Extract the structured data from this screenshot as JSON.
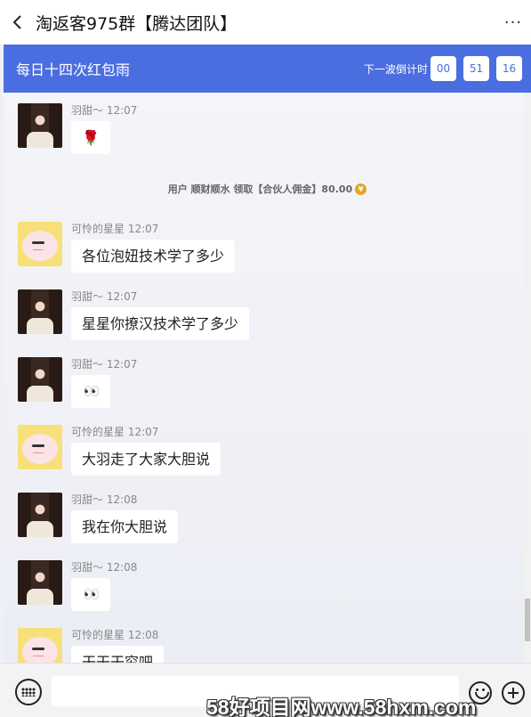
{
  "header": {
    "title": "淘返客975群【腾达团队】",
    "back_icon": "back-icon",
    "more_label": "···"
  },
  "banner": {
    "title": "每日十四次红包雨",
    "countdown_label": "下一波倒计时",
    "countdown": {
      "hours": "00",
      "minutes": "51",
      "seconds": "16"
    },
    "color": "#4a6ee0"
  },
  "messages": [
    {
      "sender": "羽甜～",
      "time": "12:07",
      "avatar": "girl-avatar",
      "content": "🌹",
      "kind": "emoji"
    },
    {
      "sender": "可怜的星星",
      "time": "12:07",
      "avatar": "pig-avatar",
      "content": "各位泡妞技术学了多少",
      "kind": "text"
    },
    {
      "sender": "羽甜～",
      "time": "12:07",
      "avatar": "girl-avatar",
      "content": "星星你撩汉技术学了多少",
      "kind": "text"
    },
    {
      "sender": "羽甜～",
      "time": "12:07",
      "avatar": "girl-avatar",
      "content": "👀",
      "kind": "emoji"
    },
    {
      "sender": "可怜的星星",
      "time": "12:07",
      "avatar": "pig-avatar",
      "content": "大羽走了大家大胆说",
      "kind": "text"
    },
    {
      "sender": "羽甜～",
      "time": "12:08",
      "avatar": "girl-avatar",
      "content": "我在你大胆说",
      "kind": "text"
    },
    {
      "sender": "羽甜～",
      "time": "12:08",
      "avatar": "girl-avatar",
      "content": "👀",
      "kind": "emoji"
    },
    {
      "sender": "可怜的星星",
      "time": "12:08",
      "avatar": "pig-avatar",
      "content": "干干干穷吧",
      "kind": "text"
    }
  ],
  "system_notice": {
    "text": "用户 顺财顺水 领取【合伙人佣金】80.00",
    "coin_icon": "coin-icon"
  },
  "input_bar": {
    "placeholder": "",
    "keyboard_icon": "keyboard-icon",
    "emoji_icon": "smiley-icon",
    "plus_icon": "plus-icon"
  },
  "watermark": "58好项目网www.58hxm.com"
}
